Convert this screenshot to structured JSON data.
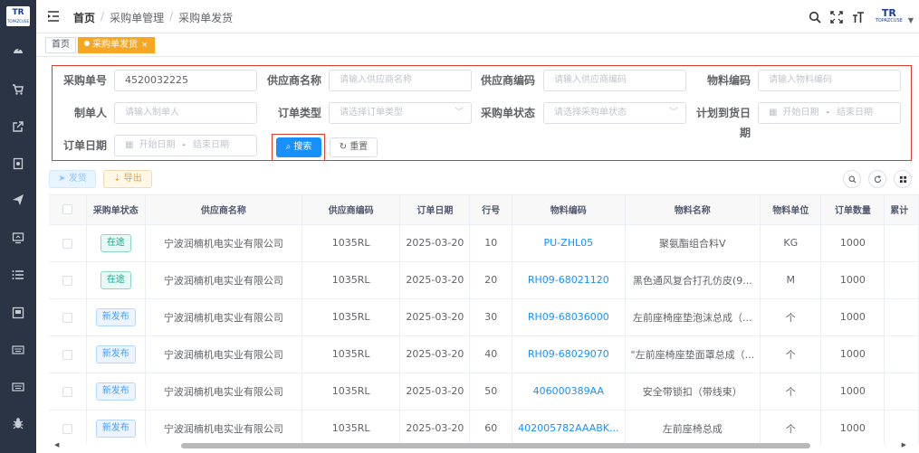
{
  "header": {
    "breadcrumb": [
      "首页",
      "采购单管理",
      "采购单发货"
    ],
    "logo_text": "TR",
    "logo_sub": "TOPAZCUSE"
  },
  "sidebar": {
    "logo_text": "TR",
    "logo_sub": "TOPAZCUSE",
    "icons": [
      "dashboard-icon",
      "cart-icon",
      "external-link-icon",
      "document-icon",
      "send-icon",
      "monitor-icon",
      "list-icon",
      "report-icon",
      "keyboard-icon",
      "keyboard-alt-icon",
      "bug-icon"
    ]
  },
  "tags": {
    "home": "首页",
    "active": "采购单发货",
    "close": "×"
  },
  "search": {
    "po_number": {
      "label": "采购单号",
      "value": "4520032225"
    },
    "supplier_name": {
      "label": "供应商名称",
      "placeholder": "请输入供应商名称"
    },
    "supplier_code": {
      "label": "供应商编码",
      "placeholder": "请输入供应商编码"
    },
    "material_code": {
      "label": "物料编码",
      "placeholder": "请输入物料编码"
    },
    "creator": {
      "label": "制单人",
      "placeholder": "请输入制单人"
    },
    "order_type": {
      "label": "订单类型",
      "placeholder": "请选择订单类型"
    },
    "po_status": {
      "label": "采购单状态",
      "placeholder": "请选择采购单状态"
    },
    "planned_date": {
      "label": "计划到货日期",
      "start": "开始日期",
      "sep": "-",
      "end": "结束日期"
    },
    "order_date": {
      "label": "订单日期",
      "start": "开始日期",
      "sep": "-",
      "end": "结束日期"
    },
    "search_btn": "搜索",
    "reset_btn": "重置"
  },
  "toolbar": {
    "send_btn": "发货",
    "export_btn": "导出"
  },
  "table": {
    "columns": [
      "采购单状态",
      "供应商名称",
      "供应商编码",
      "订单日期",
      "行号",
      "物料编码",
      "物料名称",
      "物料单位",
      "订单数量",
      "累计"
    ],
    "rows": [
      {
        "status": "在途",
        "status_type": "transit",
        "supplier": "宁波润楠机电实业有限公司",
        "code": "1035RL",
        "date": "2025-03-20",
        "line": "10",
        "material_code": "PU-ZHL05",
        "material_name": "聚氨酯组合料V",
        "unit": "KG",
        "qty": "1000"
      },
      {
        "status": "在途",
        "status_type": "transit",
        "supplier": "宁波润楠机电实业有限公司",
        "code": "1035RL",
        "date": "2025-03-20",
        "line": "20",
        "material_code": "RH09-68021120",
        "material_name": "黑色通风复合打孔仿皮(9...",
        "unit": "M",
        "qty": "1000"
      },
      {
        "status": "新发布",
        "status_type": "new",
        "supplier": "宁波润楠机电实业有限公司",
        "code": "1035RL",
        "date": "2025-03-20",
        "line": "30",
        "material_code": "RH09-68036000",
        "material_name": "左前座椅座垫泡沫总成（...",
        "unit": "个",
        "qty": "1000"
      },
      {
        "status": "新发布",
        "status_type": "new",
        "supplier": "宁波润楠机电实业有限公司",
        "code": "1035RL",
        "date": "2025-03-20",
        "line": "40",
        "material_code": "RH09-68029070",
        "material_name": "\"左前座椅座垫面罩总成（...",
        "unit": "个",
        "qty": "1000"
      },
      {
        "status": "新发布",
        "status_type": "new",
        "supplier": "宁波润楠机电实业有限公司",
        "code": "1035RL",
        "date": "2025-03-20",
        "line": "50",
        "material_code": "406000389AA",
        "material_name": "安全带锁扣（带线束）",
        "unit": "个",
        "qty": "1000"
      },
      {
        "status": "新发布",
        "status_type": "new",
        "supplier": "宁波润楠机电实业有限公司",
        "code": "1035RL",
        "date": "2025-03-20",
        "line": "60",
        "material_code": "402005782AAABK...",
        "material_name": "左前座椅总成",
        "unit": "个",
        "qty": "1000"
      }
    ]
  }
}
